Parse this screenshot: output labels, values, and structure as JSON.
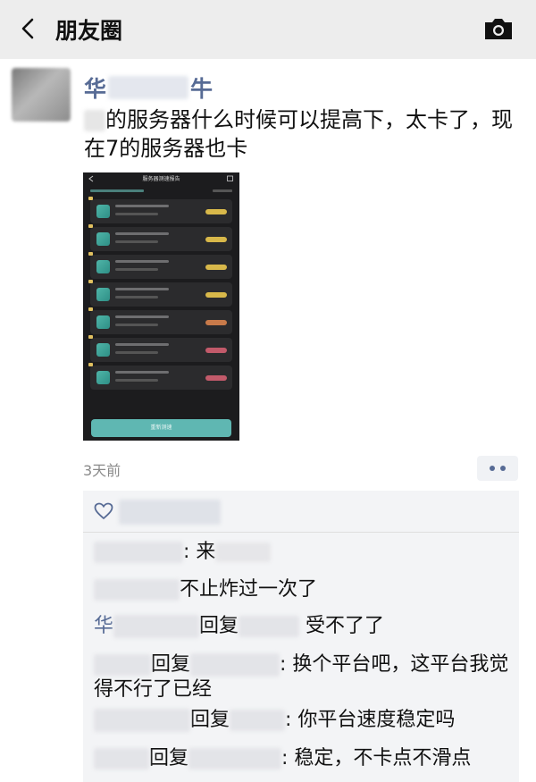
{
  "header": {
    "title": "朋友圈",
    "back_icon": "chevron-left-icon",
    "camera_icon": "camera-icon"
  },
  "post": {
    "author_first": "华",
    "author_last": "牛",
    "text": "的服务器什么时候可以提高下，太卡了，现在7的服务器也卡",
    "time": "3天前",
    "screenshot": {
      "title": "服务器测速报告",
      "button": "重新测速"
    }
  },
  "comments": [
    {
      "part1": "",
      "sep": ": 来",
      "tail": ""
    },
    {
      "part1": "",
      "sep": "不止炸过一次了",
      "tail": ""
    },
    {
      "part1": "华",
      "sep": "回复",
      "tail": " 受不了了"
    },
    {
      "part1": "",
      "sep": "回复",
      "tail": ": 换个平台吧，这平台我觉",
      "wrap": "得不行了已经"
    },
    {
      "part1": "",
      "sep": "回复",
      "tail": ": 你平台速度稳定吗"
    },
    {
      "part1": "",
      "sep": "回复",
      "tail": ": 稳定，不卡点不滑点"
    }
  ],
  "colors": {
    "link": "#576b95",
    "header_bg": "#ededed",
    "comment_bg": "#f3f4f6"
  }
}
